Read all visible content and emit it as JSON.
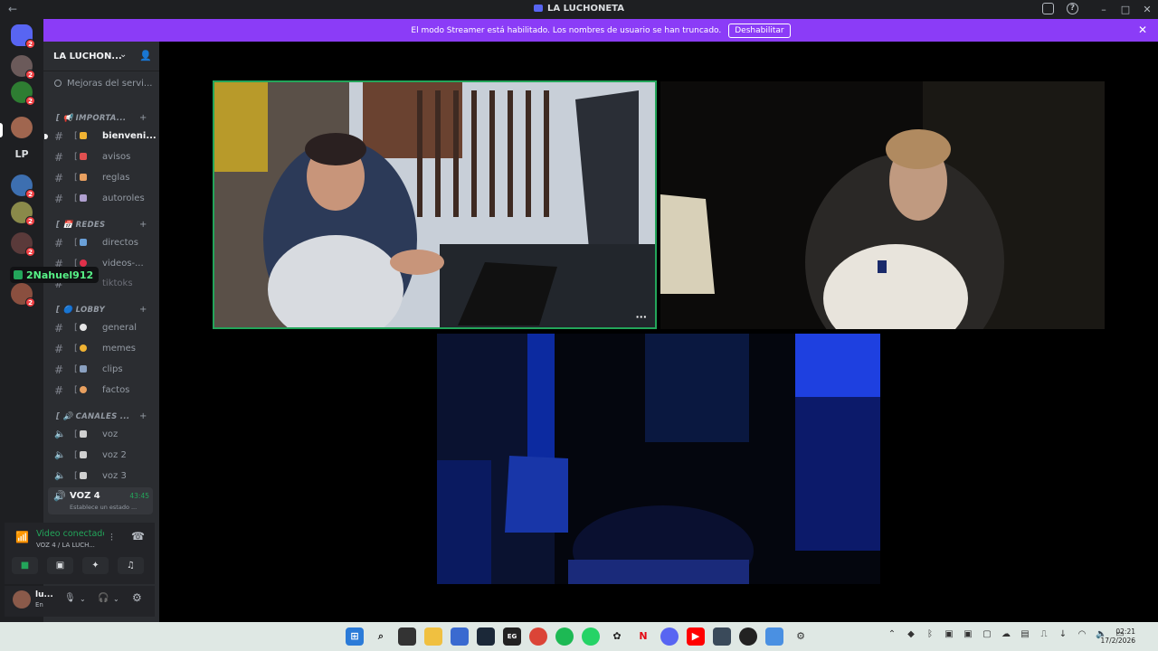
{
  "window": {
    "title": "LA LUCHONETA",
    "controls": [
      "–",
      "□",
      "✕"
    ]
  },
  "banner": {
    "message": "El modo Streamer está habilitado. Los nombres de usuario se han truncado.",
    "button": "Deshabilitar",
    "close": "✕"
  },
  "rail": {
    "lp_label": "LP",
    "badges": [
      "2",
      "2",
      "2",
      "2",
      "2",
      "2",
      "2"
    ]
  },
  "server": {
    "name": "LA LUCHON...",
    "boosts": "Mejoras del servi..."
  },
  "categories": [
    {
      "label": "[ 📢 IMPORTA...",
      "plus": "+"
    },
    {
      "label": "[ 📅 REDES",
      "plus": "+"
    },
    {
      "label": "[ 🔵 LOBBY",
      "plus": "+"
    },
    {
      "label": "[ 🔊 CANALES ...",
      "plus": "+"
    }
  ],
  "channels": {
    "bienvenida": "bienveni...",
    "avisos": "avisos",
    "reglas": "reglas",
    "autoroles": "autoroles",
    "directos": "directos",
    "videos": "videos-...",
    "tiktoks": "tiktoks",
    "general": "general",
    "memes": "memes",
    "clips": "clips",
    "factos": "factos",
    "voz": "voz",
    "voz2": "voz 2",
    "voz3": "voz 3"
  },
  "bracket": "[",
  "active_voice": {
    "name": "VOZ 4",
    "timer": "43:45",
    "status": "Establece un estado ..."
  },
  "overlay_user": "2Nahuel912",
  "voice_panel": {
    "title": "Video conectado",
    "subtitle": "VOZ 4 / LA LUCH..."
  },
  "user_panel": {
    "name": "lu...",
    "status": "En"
  },
  "video_tiles": {
    "more": "···"
  },
  "taskbar": {
    "time": "02:21",
    "date": "17/2/2026"
  },
  "colors": {
    "banner": "#8b3cf7",
    "speaking": "#23a55a",
    "sidebar": "#2b2d31",
    "rail": "#1e1f22"
  }
}
